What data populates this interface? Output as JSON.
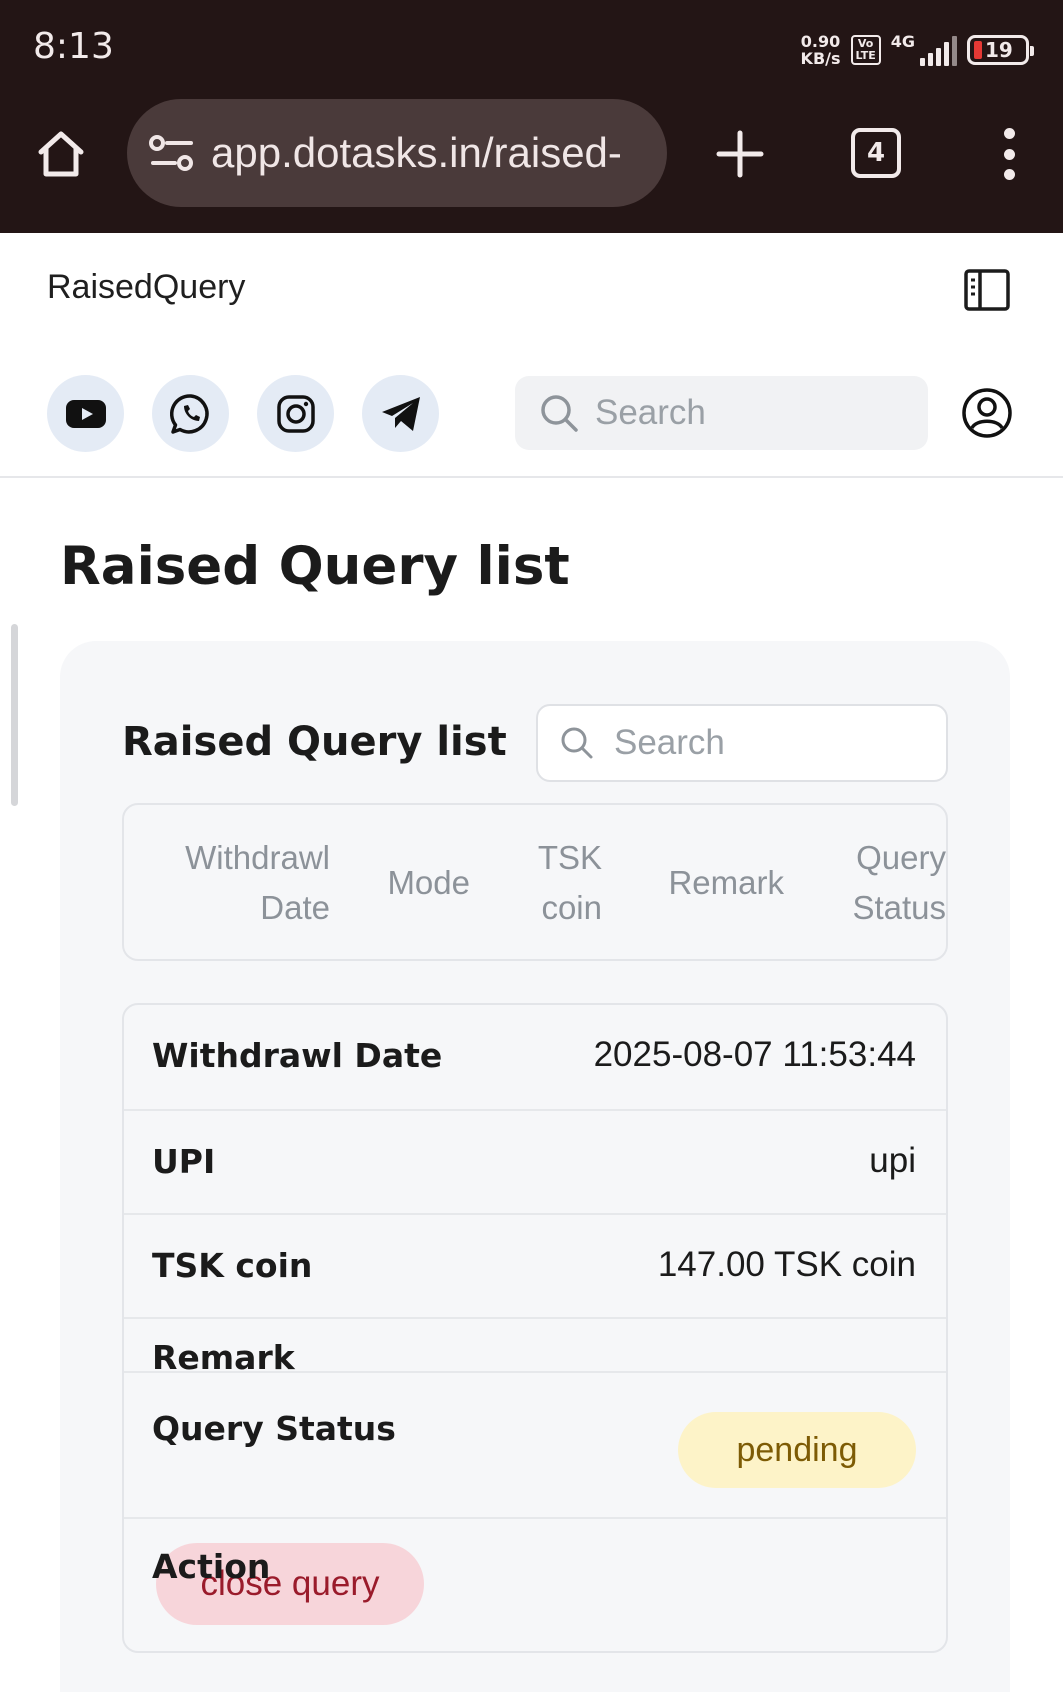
{
  "status_bar": {
    "time": "8:13",
    "net_speed_value": "0.90",
    "net_speed_unit": "KB/s",
    "volte_top": "Vo",
    "volte_bottom": "LTE",
    "network": "4G",
    "battery_level": "19",
    "battery_color": "#e53935"
  },
  "browser": {
    "url": "app.dotasks.in/raised-",
    "tab_count": "4",
    "icons": [
      "home-icon",
      "site-settings-icon",
      "plus-icon",
      "tab-switcher-icon",
      "kebab-menu-icon"
    ]
  },
  "app": {
    "title": "RaisedQuery",
    "social_icons": [
      "youtube-icon",
      "whatsapp-icon",
      "instagram-icon",
      "telegram-icon"
    ],
    "search_placeholder": "Search"
  },
  "main": {
    "page_title": "Raised Query list",
    "card": {
      "title": "Raised Query list",
      "search_placeholder": "Search",
      "columns": [
        {
          "line1": "Withdrawl",
          "line2": "Date"
        },
        {
          "line1": "Mode",
          "line2": ""
        },
        {
          "line1": "TSK",
          "line2": "coin"
        },
        {
          "line1": "Remark",
          "line2": ""
        },
        {
          "line1": "Query",
          "line2": "Status"
        }
      ],
      "record": {
        "withdrawl_date_label": "Withdrawl Date",
        "withdrawl_date_value": "2025-08-07 11:53:44",
        "mode_label": "UPI",
        "mode_value": "upi",
        "coin_label": "TSK coin",
        "coin_value": "147.00 TSK coin",
        "remark_label": "Remark",
        "remark_value": "",
        "status_label": "Query Status",
        "status_value": "pending",
        "action_label": "Action",
        "action_button": "close query"
      }
    }
  },
  "colors": {
    "chrome_bg": "#231515",
    "pending_bg": "#fdf3c8",
    "pending_text": "#7d5b05",
    "close_bg": "#f7d5da",
    "close_text": "#9a1b2b"
  }
}
